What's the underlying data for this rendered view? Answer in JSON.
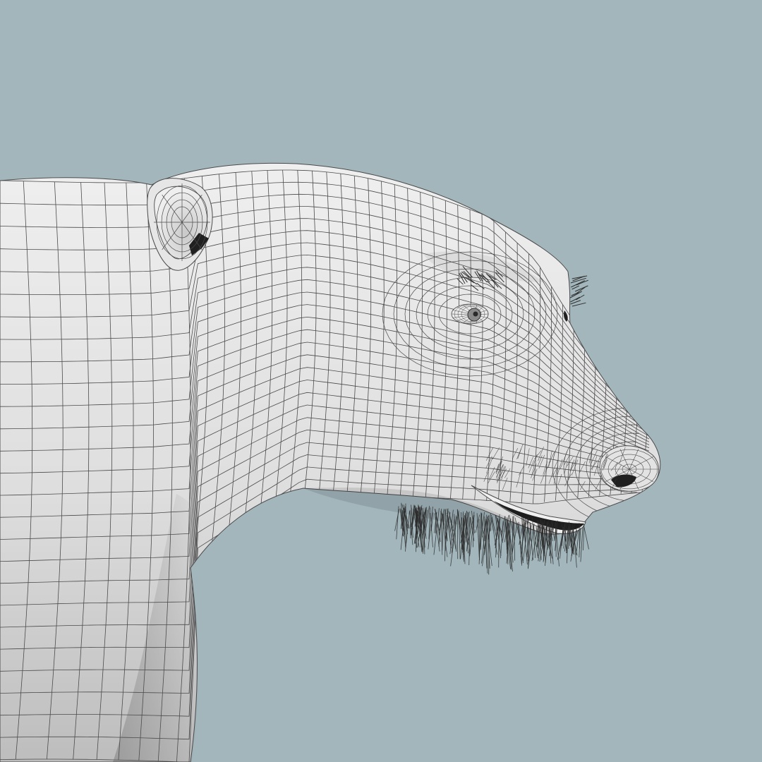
{
  "viewport": {
    "background": "#a2b6bb",
    "subject": "bear-head-wireframe-render"
  },
  "colors": {
    "surface_light": "#ececec",
    "surface_mid": "#d9d9d9",
    "surface_shadow": "#b4b4b4",
    "wire": "#4b4b4b",
    "dark": "#202020",
    "whisker": "#303030"
  }
}
